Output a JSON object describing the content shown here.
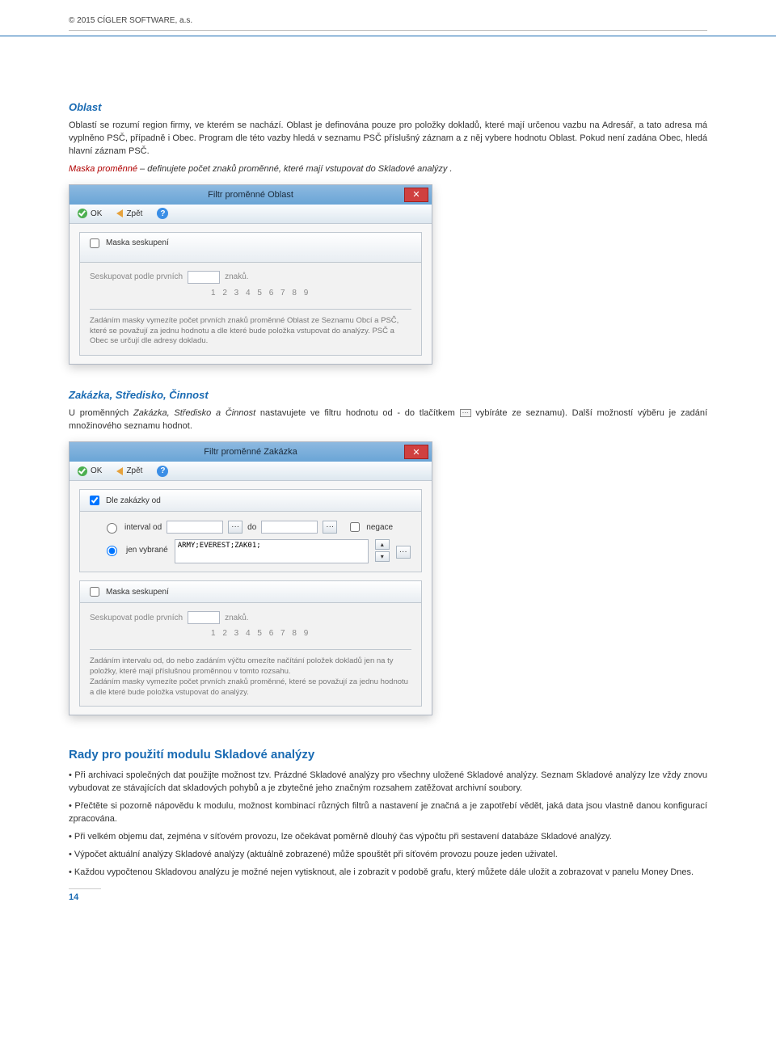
{
  "header": {
    "copyright": "© 2015 CÍGLER SOFTWARE, a.s."
  },
  "page_number": "14",
  "sections": {
    "oblast": {
      "title": "Oblast",
      "para": "Oblastí se rozumí region firmy, ve kterém se nachází. Oblast je definována pouze pro položky dokladů, které mají určenou vazbu na Adresář, a tato adresa má vyplněno PSČ, případně i Obec. Program dle této vazby hledá v seznamu PSČ příslušný záznam a z něj vybere hodnotu Oblast. Pokud není zadána Obec, hledá hlavní záznam PSČ.",
      "maska_label": "Maska proměnné",
      "maska_rest": " – definujete počet znaků proměnné, které mají vstupovat do Skladové analýzy ."
    },
    "zakazka": {
      "title": "Zakázka, Středisko, Činnost",
      "para_a": "U proměnných ",
      "para_it": "Zakázka, Středisko a Činnost",
      "para_b": " nastavujete ve filtru hodnotu od - do tlačítkem ",
      "para_c": " vybíráte ze seznamu). Další možností výběru je zadání množinového seznamu hodnot."
    },
    "rady": {
      "title": "Rady pro použití modulu Skladové analýzy",
      "bullets": [
        "Při archivaci společných dat použijte možnost  tzv. Prázdné Skladové analýzy pro všechny uložené Skladové analýzy. Seznam Skladové analýzy lze vždy znovu vybudovat ze stávajících dat  skladových pohybů a je zbytečné jeho značným rozsahem zatěžovat archivní soubory.",
        "Přečtěte si pozorně nápovědu k modulu, možnost kombinací různých filtrů a nastavení je značná a je zapotřebí vědět, jaká data jsou vlastně danou konfigurací zpracována.",
        "Při velkém objemu dat, zejména v síťovém provozu, lze očekávat poměrně dlouhý čas výpočtu při sestavení databáze Skladové analýzy.",
        "Výpočet aktuální analýzy Skladové analýzy (aktuálně zobrazené) může spouštět při síťovém provozu pouze jeden uživatel.",
        "Každou vypočtenou Skladovou analýzu je možné nejen vytisknout, ale i zobrazit v podobě grafu, který můžete dále uložit a zobrazovat v panelu Money Dnes."
      ]
    }
  },
  "dialogs": {
    "toolbar": {
      "ok": "OK",
      "zpet": "Zpět"
    },
    "oblast": {
      "title": "Filtr proměnné Oblast",
      "tab": "Maska seskupení",
      "grp_label": "Seskupovat podle prvních",
      "grp_suffix": "znaků.",
      "nums": "1 2 3 4 5 6 7 8 9",
      "note": "Zadáním masky vymezíte počet prvních znaků proměnné Oblast ze Seznamu Obcí a PSČ, které se považují za jednu hodnotu a dle které bude položka vstupovat do analýzy. PSČ a Obec se určují dle adresy dokladu."
    },
    "zakazka": {
      "title": "Filtr proměnné Zakázka",
      "tab": "Dle zakázky od",
      "interval": "interval od",
      "do": "do",
      "negace": "negace",
      "jen_vybrane": "jen vybrané",
      "sel_value": "ARMY;EVEREST;ZAK01;",
      "mask_chk": "Maska seskupení",
      "grp_label": "Seskupovat podle prvních",
      "grp_suffix": "znaků.",
      "nums": "1 2 3 4 5 6 7 8 9",
      "note": "Zadáním intervalu od, do nebo zadáním výčtu omezíte načítání položek dokladů jen na ty položky, které mají příslušnou proměnnou v tomto rozsahu.\nZadáním masky vymezíte počet prvních znaků proměnné, které se považují za jednu hodnotu a dle které bude položka vstupovat do analýzy."
    }
  }
}
